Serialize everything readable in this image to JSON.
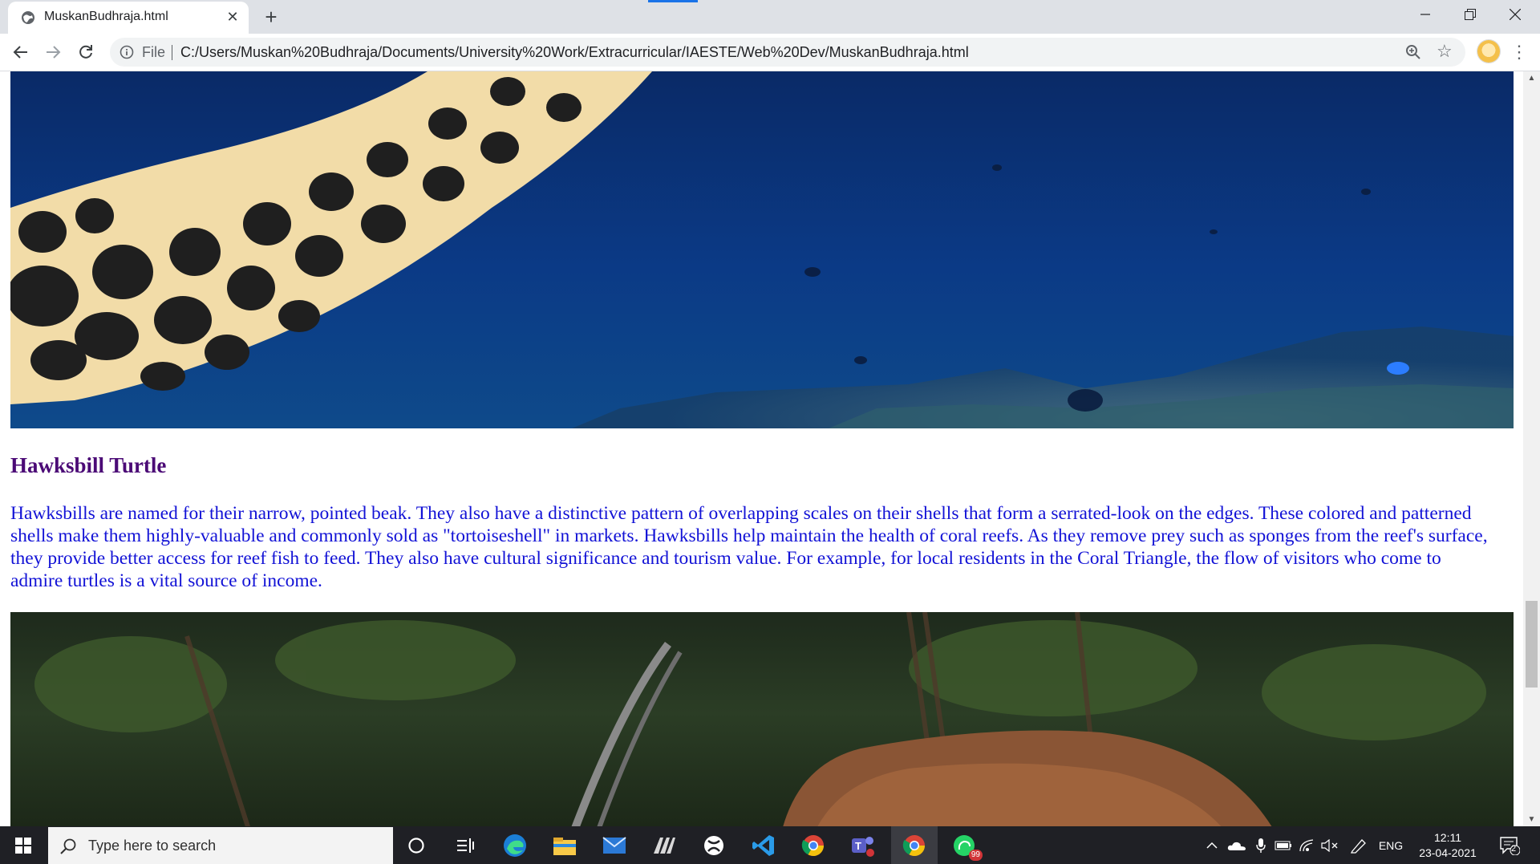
{
  "browser": {
    "tab_title": "MuskanBudhraja.html",
    "file_label": "File",
    "url": "C:/Users/Muskan%20Budhraja/Documents/University%20Work/Extracurricular/IAESTE/Web%20Dev/MuskanBudhraja.html"
  },
  "page": {
    "heading": "Hawksbill Turtle",
    "paragraph": "Hawksbills are named for their narrow, pointed beak. They also have a distinctive pattern of overlapping scales on their shells that form a serrated-look on the edges. These colored and patterned shells make them highly-valuable and commonly sold as \"tortoiseshell\" in markets. Hawksbills help maintain the health of coral reefs. As they remove prey such as sponges from the reef's surface, they provide better access for reef fish to feed. They also have cultural significance and tourism value. For example, for local residents in the Coral Triangle, the flow of visitors who come to admire turtles is a vital source of income.",
    "colors": {
      "heading": "#4b0a76",
      "paragraph": "#1212d6"
    }
  },
  "taskbar": {
    "search_placeholder": "Type here to search",
    "whatsapp_badge": "99",
    "language": "ENG",
    "time": "12:11",
    "date": "23-04-2021",
    "notification_count": "2"
  }
}
